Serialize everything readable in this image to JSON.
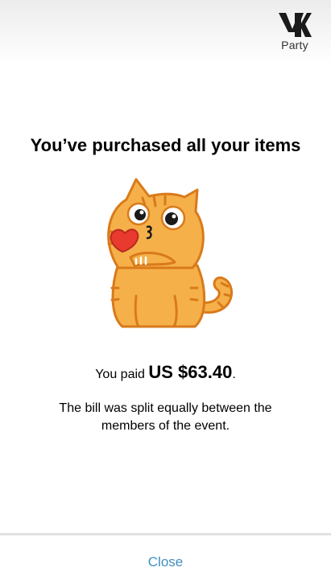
{
  "header": {
    "brand_label": "Party",
    "logo_icon": "vk-logo-icon"
  },
  "main": {
    "title": "You’ve purchased all your items",
    "sticker_icon": "cat-blowing-kiss-sticker",
    "paid_prefix": "You paid ",
    "paid_amount": "US $63.40",
    "paid_suffix": ".",
    "note": "The bill was split equally between the members of the event."
  },
  "footer": {
    "close_label": "Close"
  },
  "colors": {
    "accent": "#3f8fbf",
    "cat_fur": "#f5b04a",
    "cat_outline": "#d97a1a",
    "heart": "#e83a2e"
  }
}
